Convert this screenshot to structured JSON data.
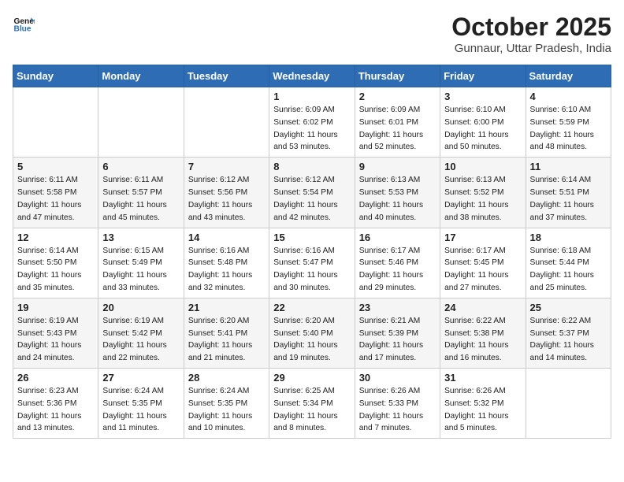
{
  "header": {
    "logo_line1": "General",
    "logo_line2": "Blue",
    "month": "October 2025",
    "location": "Gunnaur, Uttar Pradesh, India"
  },
  "days_of_week": [
    "Sunday",
    "Monday",
    "Tuesday",
    "Wednesday",
    "Thursday",
    "Friday",
    "Saturday"
  ],
  "weeks": [
    [
      {
        "day": "",
        "detail": ""
      },
      {
        "day": "",
        "detail": ""
      },
      {
        "day": "",
        "detail": ""
      },
      {
        "day": "1",
        "detail": "Sunrise: 6:09 AM\nSunset: 6:02 PM\nDaylight: 11 hours\nand 53 minutes."
      },
      {
        "day": "2",
        "detail": "Sunrise: 6:09 AM\nSunset: 6:01 PM\nDaylight: 11 hours\nand 52 minutes."
      },
      {
        "day": "3",
        "detail": "Sunrise: 6:10 AM\nSunset: 6:00 PM\nDaylight: 11 hours\nand 50 minutes."
      },
      {
        "day": "4",
        "detail": "Sunrise: 6:10 AM\nSunset: 5:59 PM\nDaylight: 11 hours\nand 48 minutes."
      }
    ],
    [
      {
        "day": "5",
        "detail": "Sunrise: 6:11 AM\nSunset: 5:58 PM\nDaylight: 11 hours\nand 47 minutes."
      },
      {
        "day": "6",
        "detail": "Sunrise: 6:11 AM\nSunset: 5:57 PM\nDaylight: 11 hours\nand 45 minutes."
      },
      {
        "day": "7",
        "detail": "Sunrise: 6:12 AM\nSunset: 5:56 PM\nDaylight: 11 hours\nand 43 minutes."
      },
      {
        "day": "8",
        "detail": "Sunrise: 6:12 AM\nSunset: 5:54 PM\nDaylight: 11 hours\nand 42 minutes."
      },
      {
        "day": "9",
        "detail": "Sunrise: 6:13 AM\nSunset: 5:53 PM\nDaylight: 11 hours\nand 40 minutes."
      },
      {
        "day": "10",
        "detail": "Sunrise: 6:13 AM\nSunset: 5:52 PM\nDaylight: 11 hours\nand 38 minutes."
      },
      {
        "day": "11",
        "detail": "Sunrise: 6:14 AM\nSunset: 5:51 PM\nDaylight: 11 hours\nand 37 minutes."
      }
    ],
    [
      {
        "day": "12",
        "detail": "Sunrise: 6:14 AM\nSunset: 5:50 PM\nDaylight: 11 hours\nand 35 minutes."
      },
      {
        "day": "13",
        "detail": "Sunrise: 6:15 AM\nSunset: 5:49 PM\nDaylight: 11 hours\nand 33 minutes."
      },
      {
        "day": "14",
        "detail": "Sunrise: 6:16 AM\nSunset: 5:48 PM\nDaylight: 11 hours\nand 32 minutes."
      },
      {
        "day": "15",
        "detail": "Sunrise: 6:16 AM\nSunset: 5:47 PM\nDaylight: 11 hours\nand 30 minutes."
      },
      {
        "day": "16",
        "detail": "Sunrise: 6:17 AM\nSunset: 5:46 PM\nDaylight: 11 hours\nand 29 minutes."
      },
      {
        "day": "17",
        "detail": "Sunrise: 6:17 AM\nSunset: 5:45 PM\nDaylight: 11 hours\nand 27 minutes."
      },
      {
        "day": "18",
        "detail": "Sunrise: 6:18 AM\nSunset: 5:44 PM\nDaylight: 11 hours\nand 25 minutes."
      }
    ],
    [
      {
        "day": "19",
        "detail": "Sunrise: 6:19 AM\nSunset: 5:43 PM\nDaylight: 11 hours\nand 24 minutes."
      },
      {
        "day": "20",
        "detail": "Sunrise: 6:19 AM\nSunset: 5:42 PM\nDaylight: 11 hours\nand 22 minutes."
      },
      {
        "day": "21",
        "detail": "Sunrise: 6:20 AM\nSunset: 5:41 PM\nDaylight: 11 hours\nand 21 minutes."
      },
      {
        "day": "22",
        "detail": "Sunrise: 6:20 AM\nSunset: 5:40 PM\nDaylight: 11 hours\nand 19 minutes."
      },
      {
        "day": "23",
        "detail": "Sunrise: 6:21 AM\nSunset: 5:39 PM\nDaylight: 11 hours\nand 17 minutes."
      },
      {
        "day": "24",
        "detail": "Sunrise: 6:22 AM\nSunset: 5:38 PM\nDaylight: 11 hours\nand 16 minutes."
      },
      {
        "day": "25",
        "detail": "Sunrise: 6:22 AM\nSunset: 5:37 PM\nDaylight: 11 hours\nand 14 minutes."
      }
    ],
    [
      {
        "day": "26",
        "detail": "Sunrise: 6:23 AM\nSunset: 5:36 PM\nDaylight: 11 hours\nand 13 minutes."
      },
      {
        "day": "27",
        "detail": "Sunrise: 6:24 AM\nSunset: 5:35 PM\nDaylight: 11 hours\nand 11 minutes."
      },
      {
        "day": "28",
        "detail": "Sunrise: 6:24 AM\nSunset: 5:35 PM\nDaylight: 11 hours\nand 10 minutes."
      },
      {
        "day": "29",
        "detail": "Sunrise: 6:25 AM\nSunset: 5:34 PM\nDaylight: 11 hours\nand 8 minutes."
      },
      {
        "day": "30",
        "detail": "Sunrise: 6:26 AM\nSunset: 5:33 PM\nDaylight: 11 hours\nand 7 minutes."
      },
      {
        "day": "31",
        "detail": "Sunrise: 6:26 AM\nSunset: 5:32 PM\nDaylight: 11 hours\nand 5 minutes."
      },
      {
        "day": "",
        "detail": ""
      }
    ]
  ]
}
